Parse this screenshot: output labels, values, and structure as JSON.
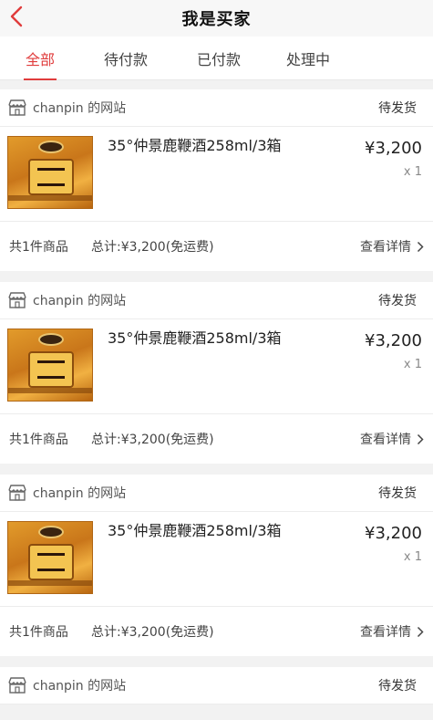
{
  "header": {
    "title": "我是买家"
  },
  "tabs": [
    {
      "label": "全部"
    },
    {
      "label": "待付款"
    },
    {
      "label": "已付款"
    },
    {
      "label": "处理中"
    }
  ],
  "colors": {
    "accent": "#e03c3c",
    "background": "#f2f2f2"
  },
  "orders": [
    {
      "shop_name": "chanpin 的网站",
      "status": "待发货",
      "product_name": "35°仲景鹿鞭酒258ml/3箱",
      "price": "¥3,200",
      "qty": "x 1",
      "count_text": "共1件商品",
      "total_text": "总计:¥3,200(免运费)",
      "detail_label": "查看详情"
    },
    {
      "shop_name": "chanpin 的网站",
      "status": "待发货",
      "product_name": "35°仲景鹿鞭酒258ml/3箱",
      "price": "¥3,200",
      "qty": "x 1",
      "count_text": "共1件商品",
      "total_text": "总计:¥3,200(免运费)",
      "detail_label": "查看详情"
    },
    {
      "shop_name": "chanpin 的网站",
      "status": "待发货",
      "product_name": "35°仲景鹿鞭酒258ml/3箱",
      "price": "¥3,200",
      "qty": "x 1",
      "count_text": "共1件商品",
      "total_text": "总计:¥3,200(免运费)",
      "detail_label": "查看详情"
    },
    {
      "shop_name": "chanpin 的网站",
      "status": "待发货"
    }
  ],
  "icons": {
    "back": "chevron-left-icon",
    "shop": "store-icon",
    "detail": "chevron-right-icon"
  }
}
